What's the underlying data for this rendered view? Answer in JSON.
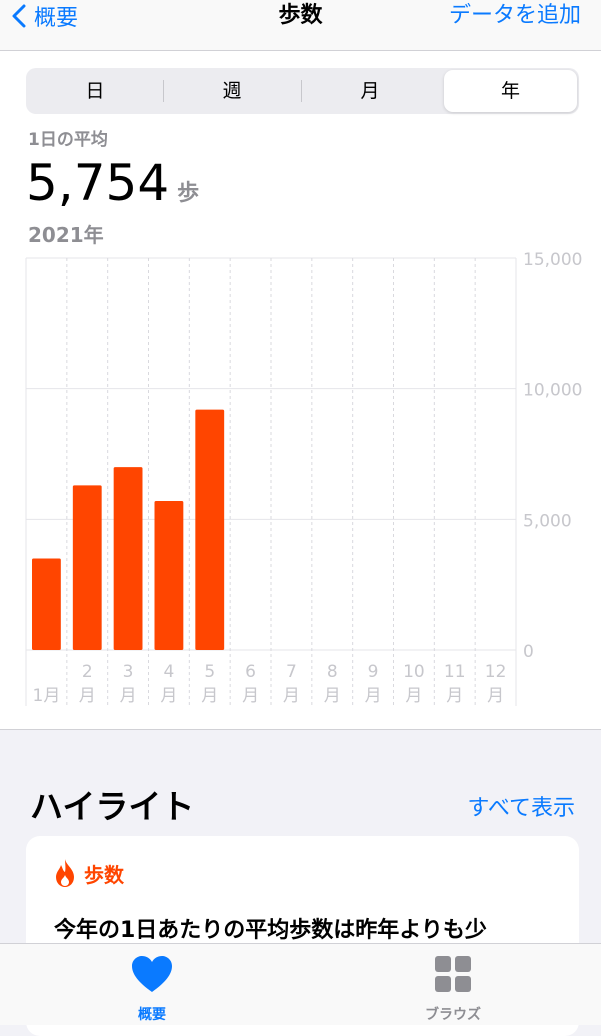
{
  "nav": {
    "back_label": "概要",
    "title": "歩数",
    "action_label": "データを追加"
  },
  "segments": [
    {
      "label": "日",
      "active": false
    },
    {
      "label": "週",
      "active": false
    },
    {
      "label": "月",
      "active": false
    },
    {
      "label": "年",
      "active": true
    }
  ],
  "summary": {
    "label": "1日の平均",
    "value": "5,754",
    "unit": "歩",
    "period": "2021年"
  },
  "chart_data": {
    "type": "bar",
    "categories": [
      "1月",
      "2月",
      "3月",
      "4月",
      "5月",
      "6月",
      "7月",
      "8月",
      "9月",
      "10月",
      "11月",
      "12月"
    ],
    "values": [
      3500,
      6300,
      7000,
      5700,
      9200,
      0,
      0,
      0,
      0,
      0,
      0,
      0
    ],
    "ylim": [
      0,
      15000
    ],
    "yticks": [
      "0",
      "5,000",
      "10,000",
      "15,000"
    ],
    "ytick_values": [
      0,
      5000,
      10000,
      15000
    ],
    "tick_numbers": [
      "1",
      "2",
      "3",
      "4",
      "5",
      "6",
      "7",
      "8",
      "9",
      "10",
      "11",
      "12"
    ],
    "tick_unit": "月",
    "bar_color": "#ff4500",
    "grid": true
  },
  "highlights": {
    "title": "ハイライト",
    "show_all": "すべて表示",
    "card_title": "歩数",
    "card_text": "今年の1日あたりの平均歩数は昨年よりも少"
  },
  "tabbar": {
    "summary_label": "概要",
    "browse_label": "ブラウズ",
    "active_color": "#0a7aff",
    "inactive_color": "#8e8e93"
  }
}
